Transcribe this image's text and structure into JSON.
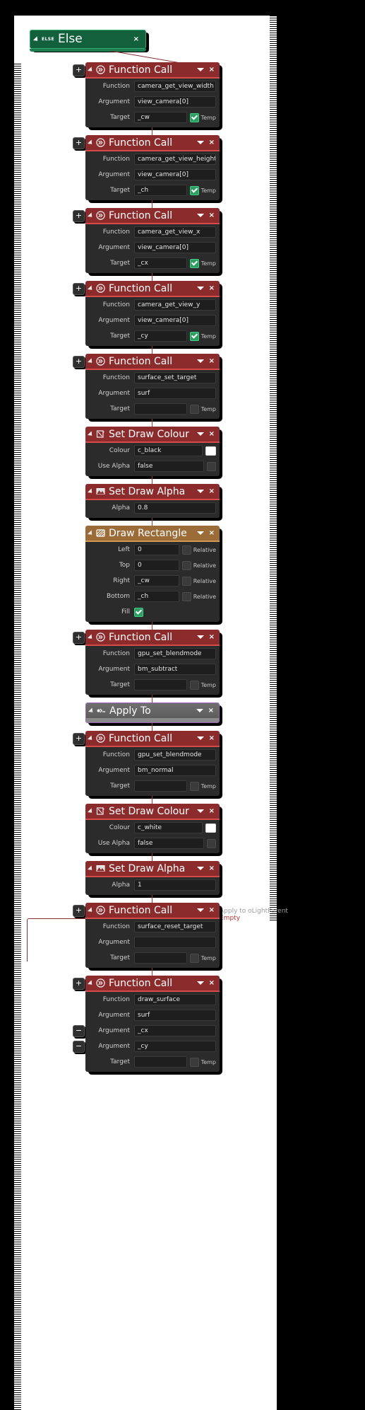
{
  "editor": {
    "name": "gml-visual-action-editor",
    "colors": {
      "function_call_header": "#8c2b2b",
      "draw_block_header": "#8c2b2b",
      "draw_rectangle_header": "#9b6b38",
      "apply_to_header": "#6e6e6e",
      "apply_to_border": "#9a64b8",
      "else_header": "#12603c",
      "body": "#2b2b2b",
      "field": "#1e1e1e",
      "check_on": "#2e9e62"
    }
  },
  "else_block": {
    "tag": "ELSE",
    "title": "Else",
    "close": "×"
  },
  "apply_note": {
    "line1": "Apply to oLightParent",
    "line2": "Empty"
  },
  "labels": {
    "function": "Function",
    "argument": "Argument",
    "target": "Target",
    "colour": "Colour",
    "use_alpha": "Use Alpha",
    "alpha": "Alpha",
    "left": "Left",
    "top": "Top",
    "right": "Right",
    "bottom": "Bottom",
    "fill": "Fill",
    "temp": "Temp",
    "relative": "Relative",
    "close": "×",
    "plus": "+",
    "minus": "−"
  },
  "blocks": [
    {
      "id": "fn-camera-get-view-width",
      "type": "function_call",
      "title": "Function Call",
      "icon": "function-call-icon",
      "sidebtn": "+",
      "rows": [
        {
          "label": "Function",
          "value": "camera_get_view_width",
          "post": "none"
        },
        {
          "label": "Argument",
          "value": "view_camera[0]",
          "post": "none"
        },
        {
          "label": "Target",
          "value": "_cw",
          "post": "temp",
          "checked": true
        }
      ]
    },
    {
      "id": "fn-camera-get-view-height",
      "type": "function_call",
      "title": "Function Call",
      "icon": "function-call-icon",
      "sidebtn": "+",
      "rows": [
        {
          "label": "Function",
          "value": "camera_get_view_height",
          "post": "none"
        },
        {
          "label": "Argument",
          "value": "view_camera[0]",
          "post": "none"
        },
        {
          "label": "Target",
          "value": "_ch",
          "post": "temp",
          "checked": true
        }
      ]
    },
    {
      "id": "fn-camera-get-view-x",
      "type": "function_call",
      "title": "Function Call",
      "icon": "function-call-icon",
      "sidebtn": "+",
      "rows": [
        {
          "label": "Function",
          "value": "camera_get_view_x",
          "post": "none"
        },
        {
          "label": "Argument",
          "value": "view_camera[0]",
          "post": "none"
        },
        {
          "label": "Target",
          "value": "_cx",
          "post": "temp",
          "checked": true
        }
      ]
    },
    {
      "id": "fn-camera-get-view-y",
      "type": "function_call",
      "title": "Function Call",
      "icon": "function-call-icon",
      "sidebtn": "+",
      "rows": [
        {
          "label": "Function",
          "value": "camera_get_view_y",
          "post": "none"
        },
        {
          "label": "Argument",
          "value": "view_camera[0]",
          "post": "none"
        },
        {
          "label": "Target",
          "value": "_cy",
          "post": "temp",
          "checked": true
        }
      ]
    },
    {
      "id": "fn-surface-set-target",
      "type": "function_call",
      "title": "Function Call",
      "icon": "function-call-icon",
      "sidebtn": "+",
      "rows": [
        {
          "label": "Function",
          "value": "surface_set_target",
          "post": "none"
        },
        {
          "label": "Argument",
          "value": "surf",
          "post": "none"
        },
        {
          "label": "Target",
          "value": "",
          "post": "temp",
          "checked": false
        }
      ]
    },
    {
      "id": "set-draw-colour-black",
      "type": "draw",
      "title": "Set Draw Colour",
      "icon": "set-draw-colour-icon",
      "sidebtn": "none",
      "rows": [
        {
          "label": "Colour",
          "value": "c_black",
          "post": "swatch",
          "swatch": "#ffffff"
        },
        {
          "label": "Use Alpha",
          "value": "false",
          "post": "check",
          "checked": false
        }
      ]
    },
    {
      "id": "set-draw-alpha-08",
      "type": "draw",
      "title": "Set Draw Alpha",
      "icon": "set-draw-alpha-icon",
      "sidebtn": "none",
      "rows": [
        {
          "label": "Alpha",
          "value": "0.8",
          "post": "none"
        }
      ]
    },
    {
      "id": "draw-rectangle",
      "type": "rectangle",
      "title": "Draw Rectangle",
      "icon": "draw-rectangle-icon",
      "sidebtn": "none",
      "rows": [
        {
          "label": "Left",
          "value": "0",
          "post": "relative",
          "checked": false
        },
        {
          "label": "Top",
          "value": "0",
          "post": "relative",
          "checked": false
        },
        {
          "label": "Right",
          "value": "_cw",
          "post": "relative",
          "checked": false
        },
        {
          "label": "Bottom",
          "value": "_ch",
          "post": "relative",
          "checked": false
        },
        {
          "label": "Fill",
          "value": "",
          "post": "fillcheck",
          "checked": true
        }
      ]
    },
    {
      "id": "fn-gpu-set-blendmode-subtract",
      "type": "function_call",
      "title": "Function Call",
      "icon": "function-call-icon",
      "sidebtn": "+",
      "rows": [
        {
          "label": "Function",
          "value": "gpu_set_blendmode",
          "post": "none"
        },
        {
          "label": "Argument",
          "value": "bm_subtract",
          "post": "none"
        },
        {
          "label": "Target",
          "value": "",
          "post": "temp",
          "checked": false
        }
      ]
    },
    {
      "id": "apply-to",
      "type": "apply_to",
      "title": "Apply To",
      "icon": "apply-to-icon",
      "sidebtn": "none",
      "rows": []
    },
    {
      "id": "fn-gpu-set-blendmode-normal",
      "type": "function_call",
      "title": "Function Call",
      "icon": "function-call-icon",
      "sidebtn": "+",
      "rows": [
        {
          "label": "Function",
          "value": "gpu_set_blendmode",
          "post": "none"
        },
        {
          "label": "Argument",
          "value": "bm_normal",
          "post": "none"
        },
        {
          "label": "Target",
          "value": "",
          "post": "temp",
          "checked": false
        }
      ]
    },
    {
      "id": "set-draw-colour-white",
      "type": "draw",
      "title": "Set Draw Colour",
      "icon": "set-draw-colour-icon",
      "sidebtn": "none",
      "rows": [
        {
          "label": "Colour",
          "value": "c_white",
          "post": "swatch",
          "swatch": "#ffffff"
        },
        {
          "label": "Use Alpha",
          "value": "false",
          "post": "check",
          "checked": false
        }
      ]
    },
    {
      "id": "set-draw-alpha-1",
      "type": "draw",
      "title": "Set Draw Alpha",
      "icon": "set-draw-alpha-icon",
      "sidebtn": "none",
      "rows": [
        {
          "label": "Alpha",
          "value": "1",
          "post": "none"
        }
      ]
    },
    {
      "id": "fn-surface-reset-target",
      "type": "function_call",
      "title": "Function Call",
      "icon": "function-call-icon",
      "sidebtn": "+",
      "rows": [
        {
          "label": "Function",
          "value": "surface_reset_target",
          "post": "none"
        },
        {
          "label": "Argument",
          "value": "",
          "post": "none"
        },
        {
          "label": "Target",
          "value": "",
          "post": "temp",
          "checked": false
        }
      ]
    },
    {
      "id": "fn-draw-surface",
      "type": "function_call",
      "title": "Function Call",
      "icon": "function-call-icon",
      "sidebtn": "+",
      "extrabtns": [
        "−",
        "−"
      ],
      "rows": [
        {
          "label": "Function",
          "value": "draw_surface",
          "post": "none"
        },
        {
          "label": "Argument",
          "value": "surf",
          "post": "none"
        },
        {
          "label": "Argument",
          "value": "_cx",
          "post": "none"
        },
        {
          "label": "Argument",
          "value": "_cy",
          "post": "none"
        },
        {
          "label": "Target",
          "value": "",
          "post": "temp",
          "checked": false
        }
      ]
    }
  ]
}
